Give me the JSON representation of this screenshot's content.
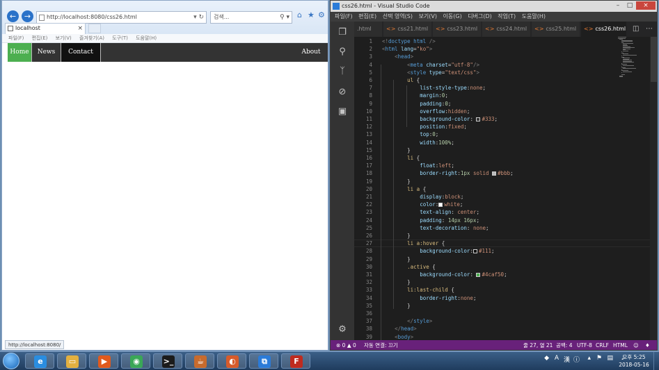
{
  "ie": {
    "address_url": "http://localhost:8080/css26.html",
    "search_placeholder": "검색...",
    "tab_title": "localhost",
    "menu": [
      "파일(F)",
      "편집(E)",
      "보기(V)",
      "즐겨찾기(A)",
      "도구(T)",
      "도움말(H)"
    ],
    "status_url": "http://localhost:8080/",
    "page_nav": {
      "home": "Home",
      "news": "News",
      "contact": "Contact",
      "about": "About"
    }
  },
  "vscode": {
    "title": "css26.html - Visual Studio Code",
    "menu": [
      "파일(F)",
      "편집(E)",
      "선택 영역(S)",
      "보기(V)",
      "이동(G)",
      "디버그(D)",
      "작업(T)",
      "도움말(H)"
    ],
    "tabs": [
      ".html",
      "css21.html",
      "css23.html",
      "css24.html",
      "css25.html",
      "css26.html"
    ],
    "active_tab": "css26.html",
    "code_lines": [
      [
        [
          "punc",
          "<!"
        ],
        [
          "tag",
          "doctype html"
        ],
        [
          "punc",
          " />"
        ]
      ],
      [
        [
          "punc",
          "<"
        ],
        [
          "tag",
          "html"
        ],
        [
          "attr",
          " lang"
        ],
        [
          "plain",
          "="
        ],
        [
          "str",
          "\"ko\""
        ],
        [
          "punc",
          ">"
        ]
      ],
      [
        [
          "plain",
          "    "
        ],
        [
          "punc",
          "<"
        ],
        [
          "tag",
          "head"
        ],
        [
          "punc",
          ">"
        ]
      ],
      [
        [
          "plain",
          "        "
        ],
        [
          "punc",
          "<"
        ],
        [
          "tag",
          "meta"
        ],
        [
          "attr",
          " charset"
        ],
        [
          "plain",
          "="
        ],
        [
          "str",
          "\"utf-8\""
        ],
        [
          "punc",
          "/>"
        ]
      ],
      [
        [
          "plain",
          "        "
        ],
        [
          "punc",
          "<"
        ],
        [
          "tag",
          "style"
        ],
        [
          "attr",
          " type"
        ],
        [
          "plain",
          "="
        ],
        [
          "str",
          "\"text/css\""
        ],
        [
          "punc",
          ">"
        ]
      ],
      [
        [
          "plain",
          "        "
        ],
        [
          "sel",
          "ul"
        ],
        [
          "plain",
          " {"
        ]
      ],
      [
        [
          "plain",
          "            "
        ],
        [
          "prop",
          "list-style-type"
        ],
        [
          "plain",
          ":"
        ],
        [
          "val",
          "none"
        ],
        [
          "plain",
          ";"
        ]
      ],
      [
        [
          "plain",
          "            "
        ],
        [
          "prop",
          "margin"
        ],
        [
          "plain",
          ":"
        ],
        [
          "num",
          "0"
        ],
        [
          "plain",
          ";"
        ]
      ],
      [
        [
          "plain",
          "            "
        ],
        [
          "prop",
          "padding"
        ],
        [
          "plain",
          ":"
        ],
        [
          "num",
          "0"
        ],
        [
          "plain",
          ";"
        ]
      ],
      [
        [
          "plain",
          "            "
        ],
        [
          "prop",
          "overflow"
        ],
        [
          "plain",
          ":"
        ],
        [
          "val",
          "hidden"
        ],
        [
          "plain",
          ";"
        ]
      ],
      [
        [
          "plain",
          "            "
        ],
        [
          "prop",
          "background-color"
        ],
        [
          "plain",
          ": "
        ],
        [
          "swatch",
          "#333333"
        ],
        [
          "val",
          "#333"
        ],
        [
          "plain",
          ";"
        ]
      ],
      [
        [
          "plain",
          "            "
        ],
        [
          "prop",
          "position"
        ],
        [
          "plain",
          ":"
        ],
        [
          "val",
          "fixed"
        ],
        [
          "plain",
          ";"
        ]
      ],
      [
        [
          "plain",
          "            "
        ],
        [
          "prop",
          "top"
        ],
        [
          "plain",
          ":"
        ],
        [
          "num",
          "0"
        ],
        [
          "plain",
          ";"
        ]
      ],
      [
        [
          "plain",
          "            "
        ],
        [
          "prop",
          "width"
        ],
        [
          "plain",
          ":"
        ],
        [
          "num",
          "100%"
        ],
        [
          "plain",
          ";"
        ]
      ],
      [
        [
          "plain",
          "        }"
        ]
      ],
      [
        [
          "plain",
          "        "
        ],
        [
          "sel",
          "li"
        ],
        [
          "plain",
          " {"
        ]
      ],
      [
        [
          "plain",
          "            "
        ],
        [
          "prop",
          "float"
        ],
        [
          "plain",
          ":"
        ],
        [
          "val",
          "left"
        ],
        [
          "plain",
          ";"
        ]
      ],
      [
        [
          "plain",
          "            "
        ],
        [
          "prop",
          "border-right"
        ],
        [
          "plain",
          ":"
        ],
        [
          "num",
          "1px"
        ],
        [
          "val",
          " solid "
        ],
        [
          "swatch",
          "#bbbbbb"
        ],
        [
          "val",
          "#bbb"
        ],
        [
          "plain",
          ";"
        ]
      ],
      [
        [
          "plain",
          "        }"
        ]
      ],
      [
        [
          "plain",
          "        "
        ],
        [
          "sel",
          "li a"
        ],
        [
          "plain",
          " {"
        ]
      ],
      [
        [
          "plain",
          "            "
        ],
        [
          "prop",
          "display"
        ],
        [
          "plain",
          ":"
        ],
        [
          "val",
          "block"
        ],
        [
          "plain",
          ";"
        ]
      ],
      [
        [
          "plain",
          "            "
        ],
        [
          "prop",
          "color"
        ],
        [
          "plain",
          ":"
        ],
        [
          "swatch",
          "#ffffff"
        ],
        [
          "val",
          "white"
        ],
        [
          "plain",
          ";"
        ]
      ],
      [
        [
          "plain",
          "            "
        ],
        [
          "prop",
          "text-align"
        ],
        [
          "plain",
          ": "
        ],
        [
          "val",
          "center"
        ],
        [
          "plain",
          ";"
        ]
      ],
      [
        [
          "plain",
          "            "
        ],
        [
          "prop",
          "padding"
        ],
        [
          "plain",
          ": "
        ],
        [
          "num",
          "14px 16px"
        ],
        [
          "plain",
          ";"
        ]
      ],
      [
        [
          "plain",
          "            "
        ],
        [
          "prop",
          "text-decoration"
        ],
        [
          "plain",
          ": "
        ],
        [
          "val",
          "none"
        ],
        [
          "plain",
          ";"
        ]
      ],
      [
        [
          "plain",
          "        }"
        ]
      ],
      [
        [
          "plain",
          "        "
        ],
        [
          "sel",
          "li a:hover"
        ],
        [
          "plain",
          " {"
        ]
      ],
      [
        [
          "plain",
          "            "
        ],
        [
          "prop",
          "background-color"
        ],
        [
          "plain",
          ":"
        ],
        [
          "swatch",
          "#111111"
        ],
        [
          "val",
          "#111"
        ],
        [
          "plain",
          ";"
        ]
      ],
      [
        [
          "plain",
          "        }"
        ]
      ],
      [
        [
          "plain",
          "        "
        ],
        [
          "sel",
          ".active"
        ],
        [
          "plain",
          " {"
        ]
      ],
      [
        [
          "plain",
          "            "
        ],
        [
          "prop",
          "background-color"
        ],
        [
          "plain",
          ": "
        ],
        [
          "swatch",
          "#4caf50"
        ],
        [
          "val",
          "#4caf50"
        ],
        [
          "plain",
          ";"
        ]
      ],
      [
        [
          "plain",
          "        }"
        ]
      ],
      [
        [
          "plain",
          "        "
        ],
        [
          "sel",
          "li:last-child"
        ],
        [
          "plain",
          " {"
        ]
      ],
      [
        [
          "plain",
          "            "
        ],
        [
          "prop",
          "border-right"
        ],
        [
          "plain",
          ":"
        ],
        [
          "val",
          "none"
        ],
        [
          "plain",
          ";"
        ]
      ],
      [
        [
          "plain",
          "        }"
        ]
      ],
      [
        [
          "plain",
          ""
        ]
      ],
      [
        [
          "plain",
          "        "
        ],
        [
          "punc",
          "</"
        ],
        [
          "tag",
          "style"
        ],
        [
          "punc",
          ">"
        ]
      ],
      [
        [
          "plain",
          "    "
        ],
        [
          "punc",
          "</"
        ],
        [
          "tag",
          "head"
        ],
        [
          "punc",
          ">"
        ]
      ],
      [
        [
          "plain",
          "    "
        ],
        [
          "punc",
          "<"
        ],
        [
          "tag",
          "body"
        ],
        [
          "punc",
          ">"
        ]
      ]
    ],
    "current_line": 27,
    "status": {
      "problems": "⊗ 0  ▲ 0",
      "live_share": "자동 연결: 끄기",
      "position": "줄 27, 열 21",
      "spaces": "공백: 4",
      "encoding": "UTF-8",
      "eol": "CRLF",
      "language": "HTML"
    }
  },
  "taskbar": {
    "apps": [
      {
        "name": "Internet Explorer",
        "icon": "ie-icon",
        "color": "#2a8de0"
      },
      {
        "name": "Explorer",
        "icon": "folder-icon",
        "color": "#e3b040"
      },
      {
        "name": "Media",
        "icon": "media-icon",
        "color": "#e05a1e"
      },
      {
        "name": "Chrome",
        "icon": "chrome-icon",
        "color": "#3aa757"
      },
      {
        "name": "Terminal",
        "icon": "terminal-icon",
        "color": "#1b1b1b"
      },
      {
        "name": "Java",
        "icon": "java-icon",
        "color": "#c86b2d"
      },
      {
        "name": "Eclipse",
        "icon": "eclipse-icon",
        "color": "#d75b2b"
      },
      {
        "name": "VS Code",
        "icon": "vscode-icon",
        "color": "#2b7bd8"
      },
      {
        "name": "FileZilla",
        "icon": "filezilla-icon",
        "color": "#bf2b1f"
      }
    ],
    "clock_time": "오후 5:25",
    "clock_date": "2018-05-16"
  },
  "colors": {
    "nav_bg": "#333333",
    "nav_active": "#4caf50",
    "nav_hover": "#111111",
    "vs_status": "#68217a"
  }
}
